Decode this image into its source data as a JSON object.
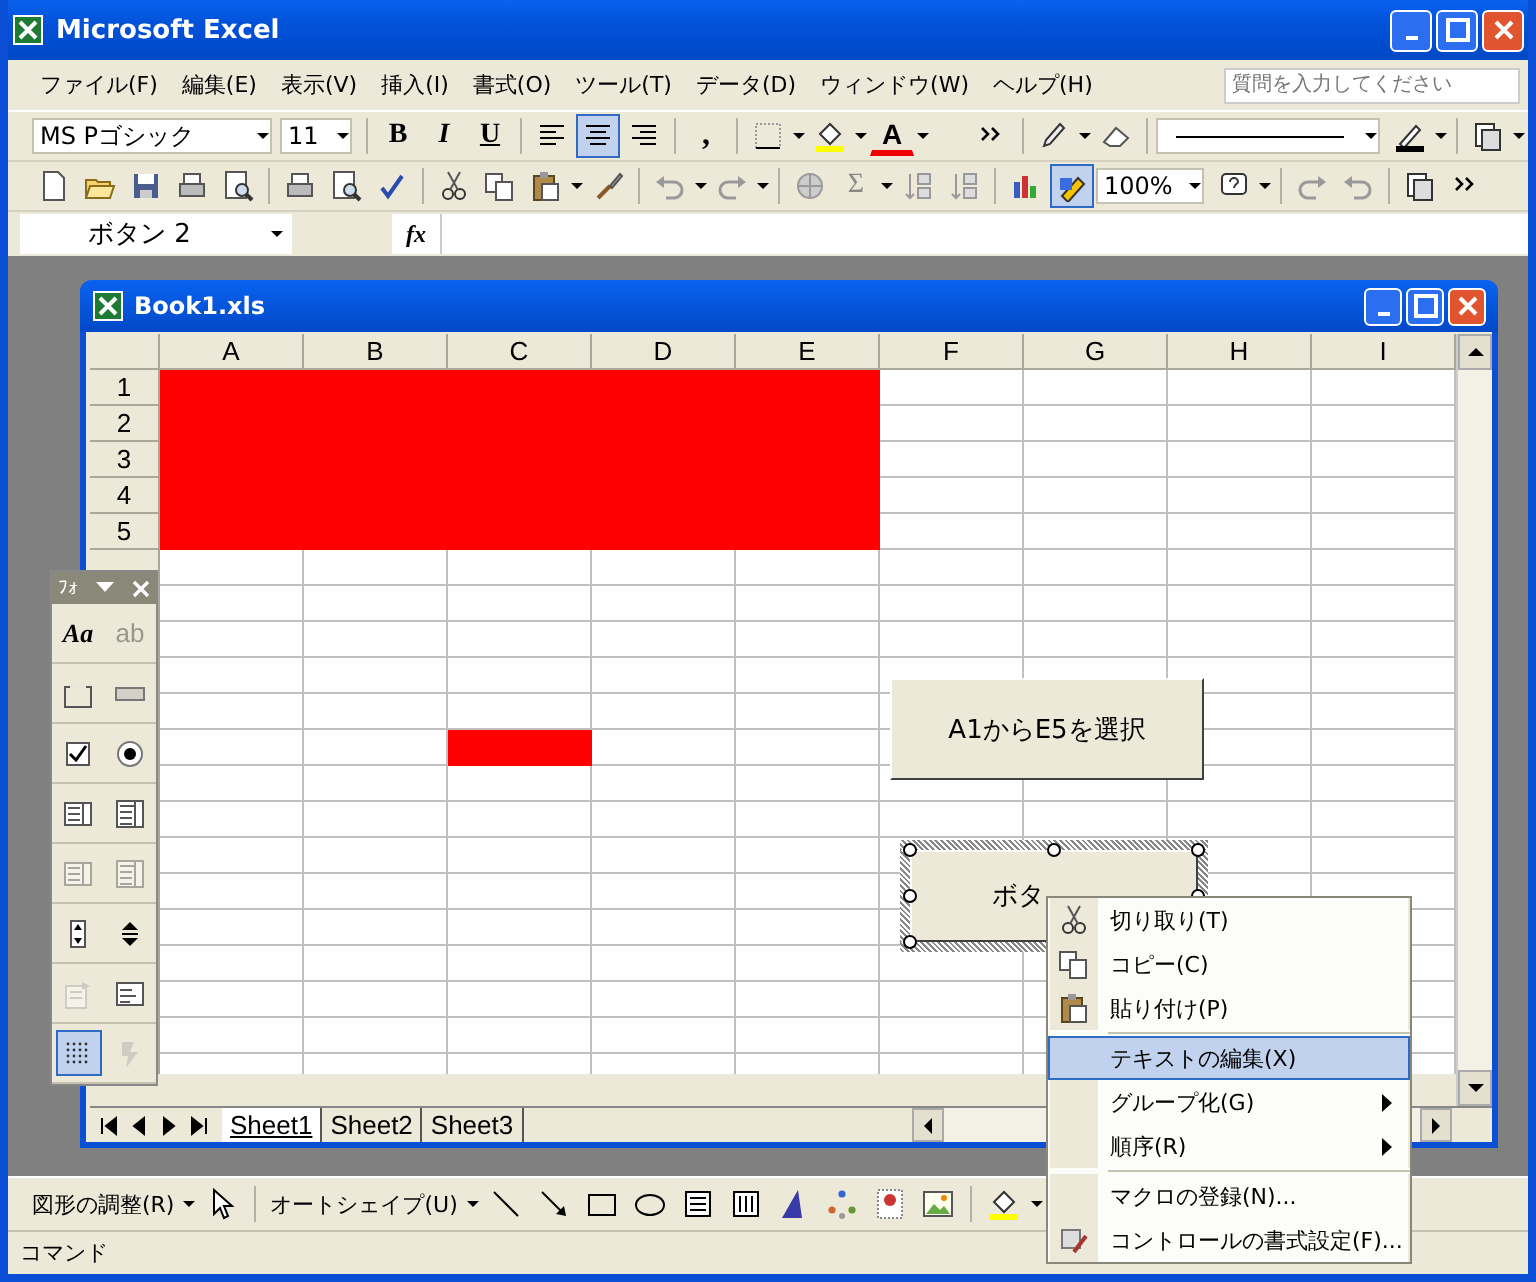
{
  "window": {
    "title": "Microsoft Excel"
  },
  "menu": [
    "ファイル(F)",
    "編集(E)",
    "表示(V)",
    "挿入(I)",
    "書式(O)",
    "ツール(T)",
    "データ(D)",
    "ウィンドウ(W)",
    "ヘルプ(H)"
  ],
  "help_search": {
    "placeholder": "質問を入力してください"
  },
  "formatting_toolbar": {
    "font": "MS Pゴシック",
    "size": "11",
    "style_buttons": [
      "B",
      "I",
      "U"
    ],
    "alignment_buttons": [
      {
        "selected": false
      },
      {
        "selected": true
      },
      {
        "selected": false
      }
    ],
    "comma": ",",
    "font_color_label": "A"
  },
  "standard_toolbar": {
    "sum": "Σ",
    "zoom": "100%",
    "drawing_button": {
      "selected": true
    }
  },
  "formula_bar": {
    "name_box": "ボタン 2",
    "fx": "fx"
  },
  "workbook": {
    "title": "Book1.xls",
    "columns": [
      "A",
      "B",
      "C",
      "D",
      "E",
      "F",
      "G",
      "H",
      "I"
    ],
    "rows": [
      {
        "label": "1",
        "filled": [
          true,
          true,
          true,
          true,
          true
        ]
      },
      {
        "label": "2",
        "filled": [
          true,
          true,
          true,
          true,
          true
        ]
      },
      {
        "label": "3",
        "filled": [
          true,
          true,
          true,
          true,
          true
        ]
      },
      {
        "label": "4",
        "filled": [
          true,
          true,
          true,
          true,
          true
        ]
      },
      {
        "label": "5",
        "filled": [
          true,
          true,
          true,
          true,
          true
        ]
      },
      {},
      {},
      {},
      {},
      {},
      {
        "filled": [
          false,
          false,
          true,
          false,
          false
        ]
      },
      {},
      {},
      {},
      {},
      {},
      {},
      {},
      {},
      {}
    ],
    "buttons": [
      {
        "label": "A1からE5を選択",
        "selected": false
      },
      {
        "label": "ボタ",
        "selected": true
      }
    ],
    "sheet_tabs": [
      {
        "label": "Sheet1",
        "selected": true
      },
      {
        "label": "Sheet2",
        "selected": false
      },
      {
        "label": "Sheet3",
        "selected": false
      }
    ]
  },
  "forms_toolbar": {
    "title": "ﾌｫ",
    "tools": [
      {
        "kind": "label",
        "text": "Aa",
        "disabled": false,
        "selected": false
      },
      {
        "kind": "editbox",
        "text": "ab",
        "disabled": true,
        "selected": false
      },
      {
        "kind": "groupbox",
        "disabled": false,
        "selected": false
      },
      {
        "kind": "button",
        "disabled": false,
        "selected": false
      },
      {
        "kind": "checkbox",
        "disabled": false,
        "selected": false
      },
      {
        "kind": "radio",
        "disabled": false,
        "selected": false
      },
      {
        "kind": "listbox",
        "disabled": false,
        "selected": false
      },
      {
        "kind": "combobox",
        "disabled": false,
        "selected": false
      },
      {
        "kind": "listbox",
        "disabled": true,
        "selected": false
      },
      {
        "kind": "combobox",
        "disabled": true,
        "selected": false
      },
      {
        "kind": "spinner",
        "disabled": false,
        "selected": false
      },
      {
        "kind": "scrollbar",
        "disabled": false,
        "selected": false
      },
      {
        "kind": "properties",
        "disabled": true,
        "selected": false
      },
      {
        "kind": "code",
        "disabled": false,
        "selected": false
      },
      {
        "kind": "grid",
        "disabled": false,
        "selected": true
      },
      {
        "kind": "run",
        "disabled": true,
        "selected": false
      }
    ]
  },
  "context_menu": [
    {
      "kind": "command",
      "label": "切り取り(T)",
      "selected": false,
      "submenu": false
    },
    {
      "kind": "command",
      "label": "コピー(C)",
      "selected": false,
      "submenu": false
    },
    {
      "kind": "command",
      "label": "貼り付け(P)",
      "selected": false,
      "submenu": false
    },
    {
      "kind": "separator"
    },
    {
      "kind": "command",
      "label": "テキストの編集(X)",
      "selected": true,
      "submenu": false
    },
    {
      "kind": "command",
      "label": "グループ化(G)",
      "selected": false,
      "submenu": true
    },
    {
      "kind": "command",
      "label": "順序(R)",
      "selected": false,
      "submenu": true
    },
    {
      "kind": "separator"
    },
    {
      "kind": "command",
      "label": "マクロの登録(N)...",
      "selected": false,
      "submenu": false
    },
    {
      "kind": "command",
      "label": "コントロールの書式設定(F)...",
      "selected": false,
      "submenu": false
    }
  ],
  "drawing_toolbar": {
    "draw_menu": "図形の調整(R)",
    "autoshapes_menu": "オートシェイプ(U)"
  },
  "status_bar": {
    "text": "コマンド"
  }
}
